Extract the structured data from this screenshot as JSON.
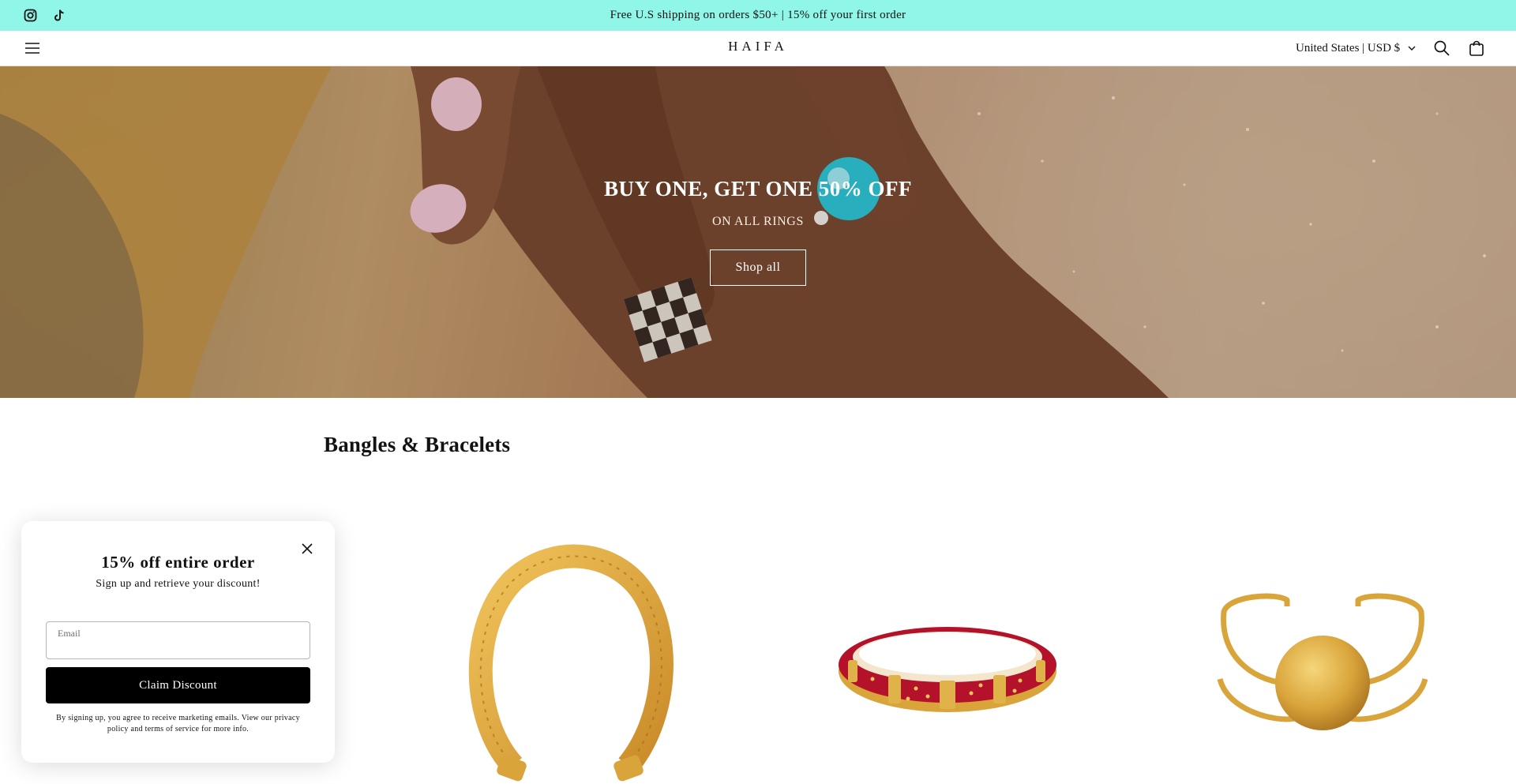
{
  "announcement": {
    "text": "Free U.S shipping on orders $50+ | 15% off your first order",
    "social": [
      "instagram-icon",
      "tiktok-icon"
    ]
  },
  "header": {
    "logo": "HAIFA",
    "country_selector": "United States | USD $",
    "icons": [
      "menu-icon",
      "search-icon",
      "cart-icon"
    ]
  },
  "hero": {
    "title": "BUY ONE, GET ONE 50% OFF",
    "subtitle": "ON ALL RINGS",
    "button_label": "Shop all"
  },
  "collection": {
    "title": "Bangles & Bracelets",
    "products": [
      "twisted-gold-cuff",
      "red-enamel-bangle",
      "gold-sphere-cuff"
    ]
  },
  "popup": {
    "title": "15% off entire order",
    "subtitle": "Sign up and retrieve your discount!",
    "email_label": "Email",
    "button_label": "Claim Discount",
    "legal": "By signing up, you agree to receive marketing emails. View our privacy policy and terms of service for more info."
  },
  "colors": {
    "announcement_bg": "#8ff6e8",
    "button_bg": "#000000",
    "gold": "#d9a43a",
    "enamel_red": "#b3122a",
    "turquoise": "#2ec6d8"
  }
}
